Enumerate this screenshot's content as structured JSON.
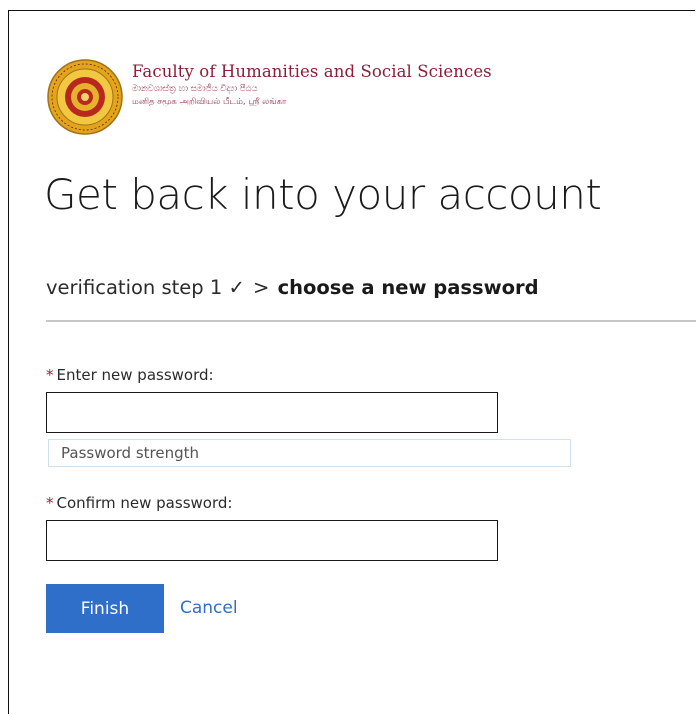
{
  "header": {
    "brand_title": "Faculty of Humanities and Social Sciences",
    "brand_subtitle_si": "මානවශාස්ත්‍ර හා සමාජීය විද්‍යා පීඨය",
    "brand_subtitle_ta": "மனித சமூக அறிவியல் பீடம், ஸ்ரீ லங்கா"
  },
  "page": {
    "title": "Get back into your account"
  },
  "steps": {
    "completed": "verification step 1 ✓",
    "separator": ">",
    "current": "choose a new password"
  },
  "form": {
    "required_marker": "*",
    "new_password_label": "Enter new password:",
    "new_password_value": "",
    "strength_label": "Password strength",
    "confirm_password_label": "Confirm new password:",
    "confirm_password_value": ""
  },
  "actions": {
    "finish_label": "Finish",
    "cancel_label": "Cancel"
  },
  "colors": {
    "accent": "#2f6ec9",
    "brand_text": "#8a1f3a",
    "required": "#c8102e",
    "seal_gold": "#d6a21a",
    "seal_red": "#b0231f"
  }
}
